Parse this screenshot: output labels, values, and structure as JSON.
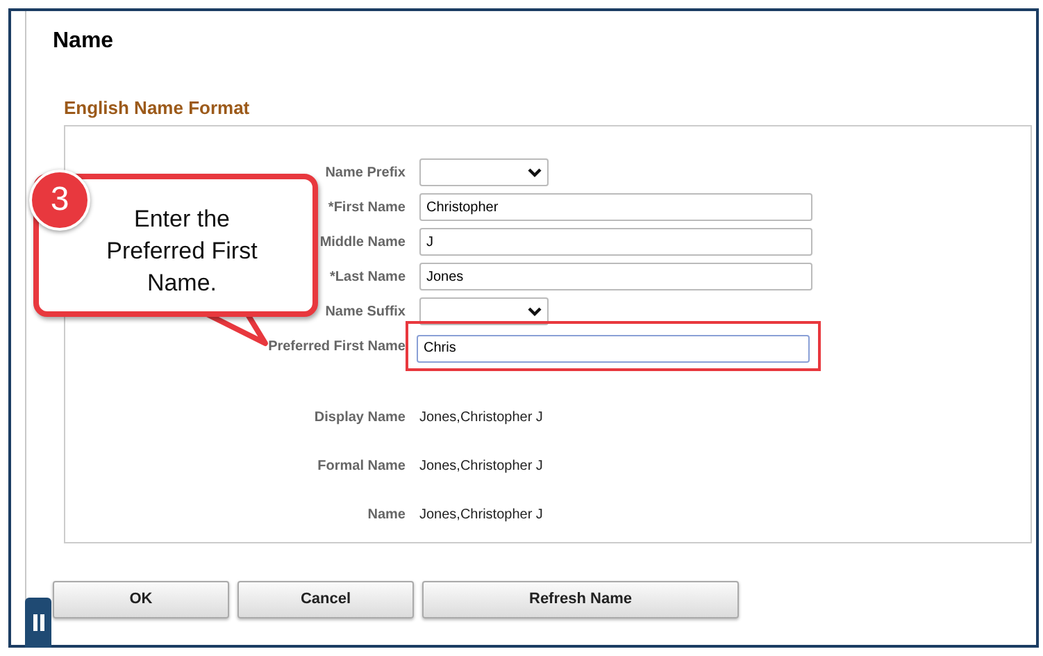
{
  "page_title": "Name",
  "section": {
    "title": "English Name Format",
    "fields": [
      {
        "label": "Name Prefix",
        "kind": "select",
        "highlighted": false
      },
      {
        "label": "*First Name",
        "kind": "text",
        "value": "Christopher",
        "highlighted": false
      },
      {
        "label": "Middle Name",
        "kind": "text",
        "value": "J",
        "highlighted": false
      },
      {
        "label": "*Last Name",
        "kind": "text",
        "value": "Jones",
        "highlighted": false
      },
      {
        "label": "Name Suffix",
        "kind": "select",
        "highlighted": false
      },
      {
        "label": "Preferred First Name",
        "kind": "text",
        "value": "Chris",
        "highlighted": true
      }
    ],
    "display_rows": [
      {
        "label": "Display Name",
        "value": "Jones,Christopher J"
      },
      {
        "label": "Formal Name",
        "value": "Jones,Christopher J"
      },
      {
        "label": "Name",
        "value": "Jones,Christopher J"
      }
    ]
  },
  "buttons": [
    {
      "label": "OK"
    },
    {
      "label": "Cancel"
    },
    {
      "label": "Refresh Name"
    }
  ],
  "callout": {
    "step": "3",
    "text": "Enter the Preferred First Name."
  }
}
